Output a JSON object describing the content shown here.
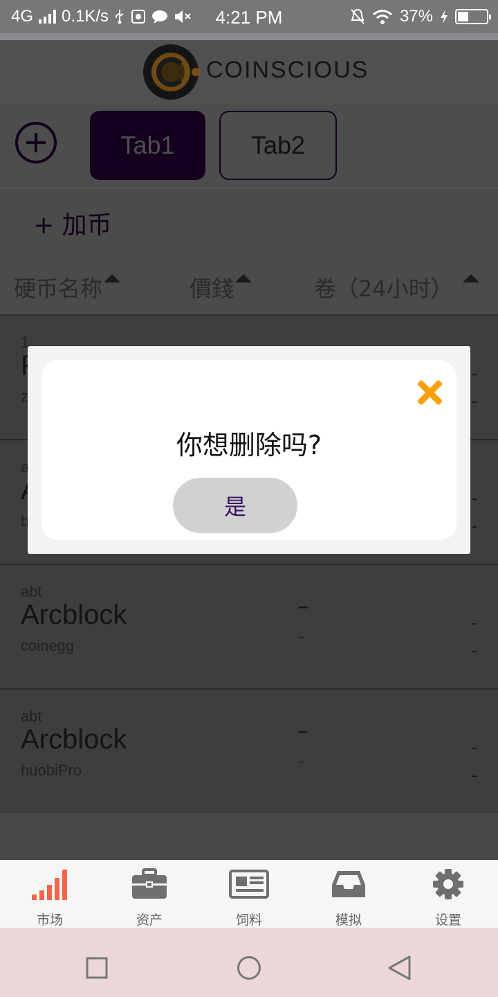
{
  "status_bar": {
    "network": "4G",
    "speed": "0.1K/s",
    "time": "4:21 PM",
    "battery": "37%",
    "battery_level": 0.37
  },
  "header": {
    "logo_text": "COINSCIOUS"
  },
  "tabs": [
    {
      "label": "Tab1",
      "active": true
    },
    {
      "label": "Tab2",
      "active": false
    }
  ],
  "add_coin": {
    "label": "+ 加币"
  },
  "columns": {
    "name": "硬币名称",
    "price": "價錢",
    "volume": "卷（24小时）"
  },
  "rows": [
    {
      "symbol": "1",
      "name": "F",
      "exchange": "z",
      "price": "",
      "change": "",
      "volume": "-",
      "volume2": "-"
    },
    {
      "symbol": "a",
      "name": "A",
      "exchange": "b",
      "price": "",
      "change": "",
      "volume": "-",
      "volume2": "-"
    },
    {
      "symbol": "abt",
      "name": "Arcblock",
      "exchange": "coinegg",
      "price": "–",
      "change": "–",
      "volume": "-",
      "volume2": "-"
    },
    {
      "symbol": "abt",
      "name": "Arcblock",
      "exchange": "huobiPro",
      "price": "–",
      "change": "–",
      "volume": "-",
      "volume2": "-"
    }
  ],
  "bottom_nav": [
    {
      "label": "市场",
      "icon": "signal-bars-icon",
      "active": true,
      "color": "#f4644a"
    },
    {
      "label": "资产",
      "icon": "briefcase-icon",
      "active": false
    },
    {
      "label": "饲料",
      "icon": "newspaper-icon",
      "active": false
    },
    {
      "label": "模拟",
      "icon": "inbox-tray-icon",
      "active": false
    },
    {
      "label": "设置",
      "icon": "gear-icon",
      "active": false
    }
  ],
  "dialog": {
    "question": "你想删除吗?",
    "confirm_label": "是",
    "close_color": "#f9a10d"
  }
}
